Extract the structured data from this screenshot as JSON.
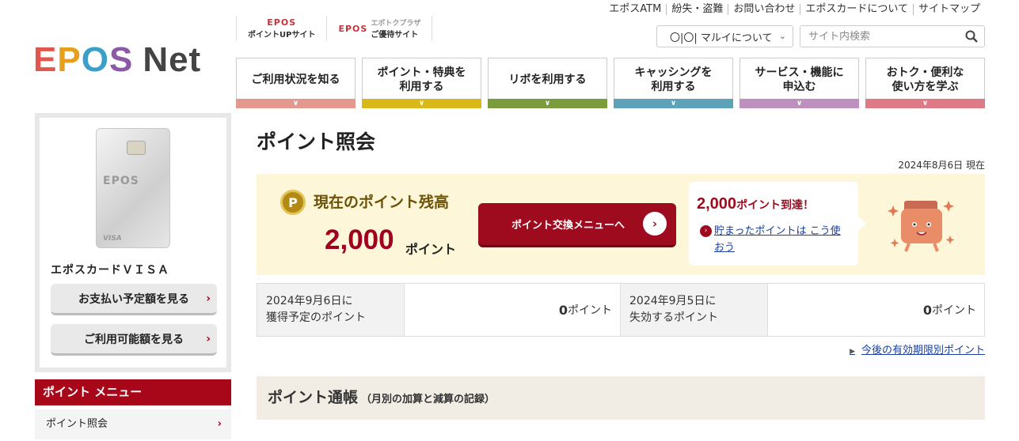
{
  "logo": {
    "e": "E",
    "p": "P",
    "o": "O",
    "s": "S",
    "net": "Net",
    "alt": "EPOS Net"
  },
  "site_links": [
    {
      "brand": "EPOS",
      "label": "ポイントUPサイト"
    },
    {
      "brand": "EPOS",
      "sub": "エポトクプラザ",
      "label": "ご優待サイト"
    }
  ],
  "util_nav": [
    "エポスATM",
    "紛失・盗難",
    "お問い合わせ",
    "エポスカードについて",
    "サイトマップ"
  ],
  "marui_select": {
    "value": "〇|〇| マルイについて"
  },
  "search": {
    "placeholder": "サイト内検索"
  },
  "main_nav": [
    {
      "label": "ご利用状況を知る",
      "color": "#e3998d"
    },
    {
      "label": "ポイント・特典を\n利用する",
      "color": "#d9b91a"
    },
    {
      "label": "リボを利用する",
      "color": "#7a9c3d"
    },
    {
      "label": "キャッシングを\n利用する",
      "color": "#5da2b8"
    },
    {
      "label": "サービス・機能に\n申込む",
      "color": "#bf8fc0"
    },
    {
      "label": "おトク・便利な\n使い方を学ぶ",
      "color": "#dd7a86"
    }
  ],
  "sidebar": {
    "card_logo": "EPOS",
    "card_visa": "VISA",
    "card_name": "エポスカードＶＩＳＡ",
    "btn_payment": "お支払い予定額を見る",
    "btn_available": "ご利用可能額を見る",
    "menu_title": "ポイント メニュー",
    "menu_item": "ポイント照会"
  },
  "main": {
    "title": "ポイント照会",
    "as_of": "2024年8月6日 現在",
    "balance_label": "現在のポイント残高",
    "balance_value": "2,000",
    "balance_unit": "ポイント",
    "exchange_button": "ポイント交換メニューへ",
    "reached_value": "2,000",
    "reached_suffix": "ポイント到達！",
    "reached_link": "貯まったポイントは こう使おう",
    "table": {
      "earn_label_1": "2024年9月6日に",
      "earn_label_2": "獲得予定のポイント",
      "earn_value": "0",
      "expire_label_1": "2024年9月5日に",
      "expire_label_2": "失効するポイント",
      "expire_value": "0",
      "unit": "ポイント"
    },
    "expiry_link": "今後の有効期限別ポイント",
    "passbook_title": "ポイント通帳",
    "passbook_sub": "（月別の加算と減算の記録）"
  }
}
